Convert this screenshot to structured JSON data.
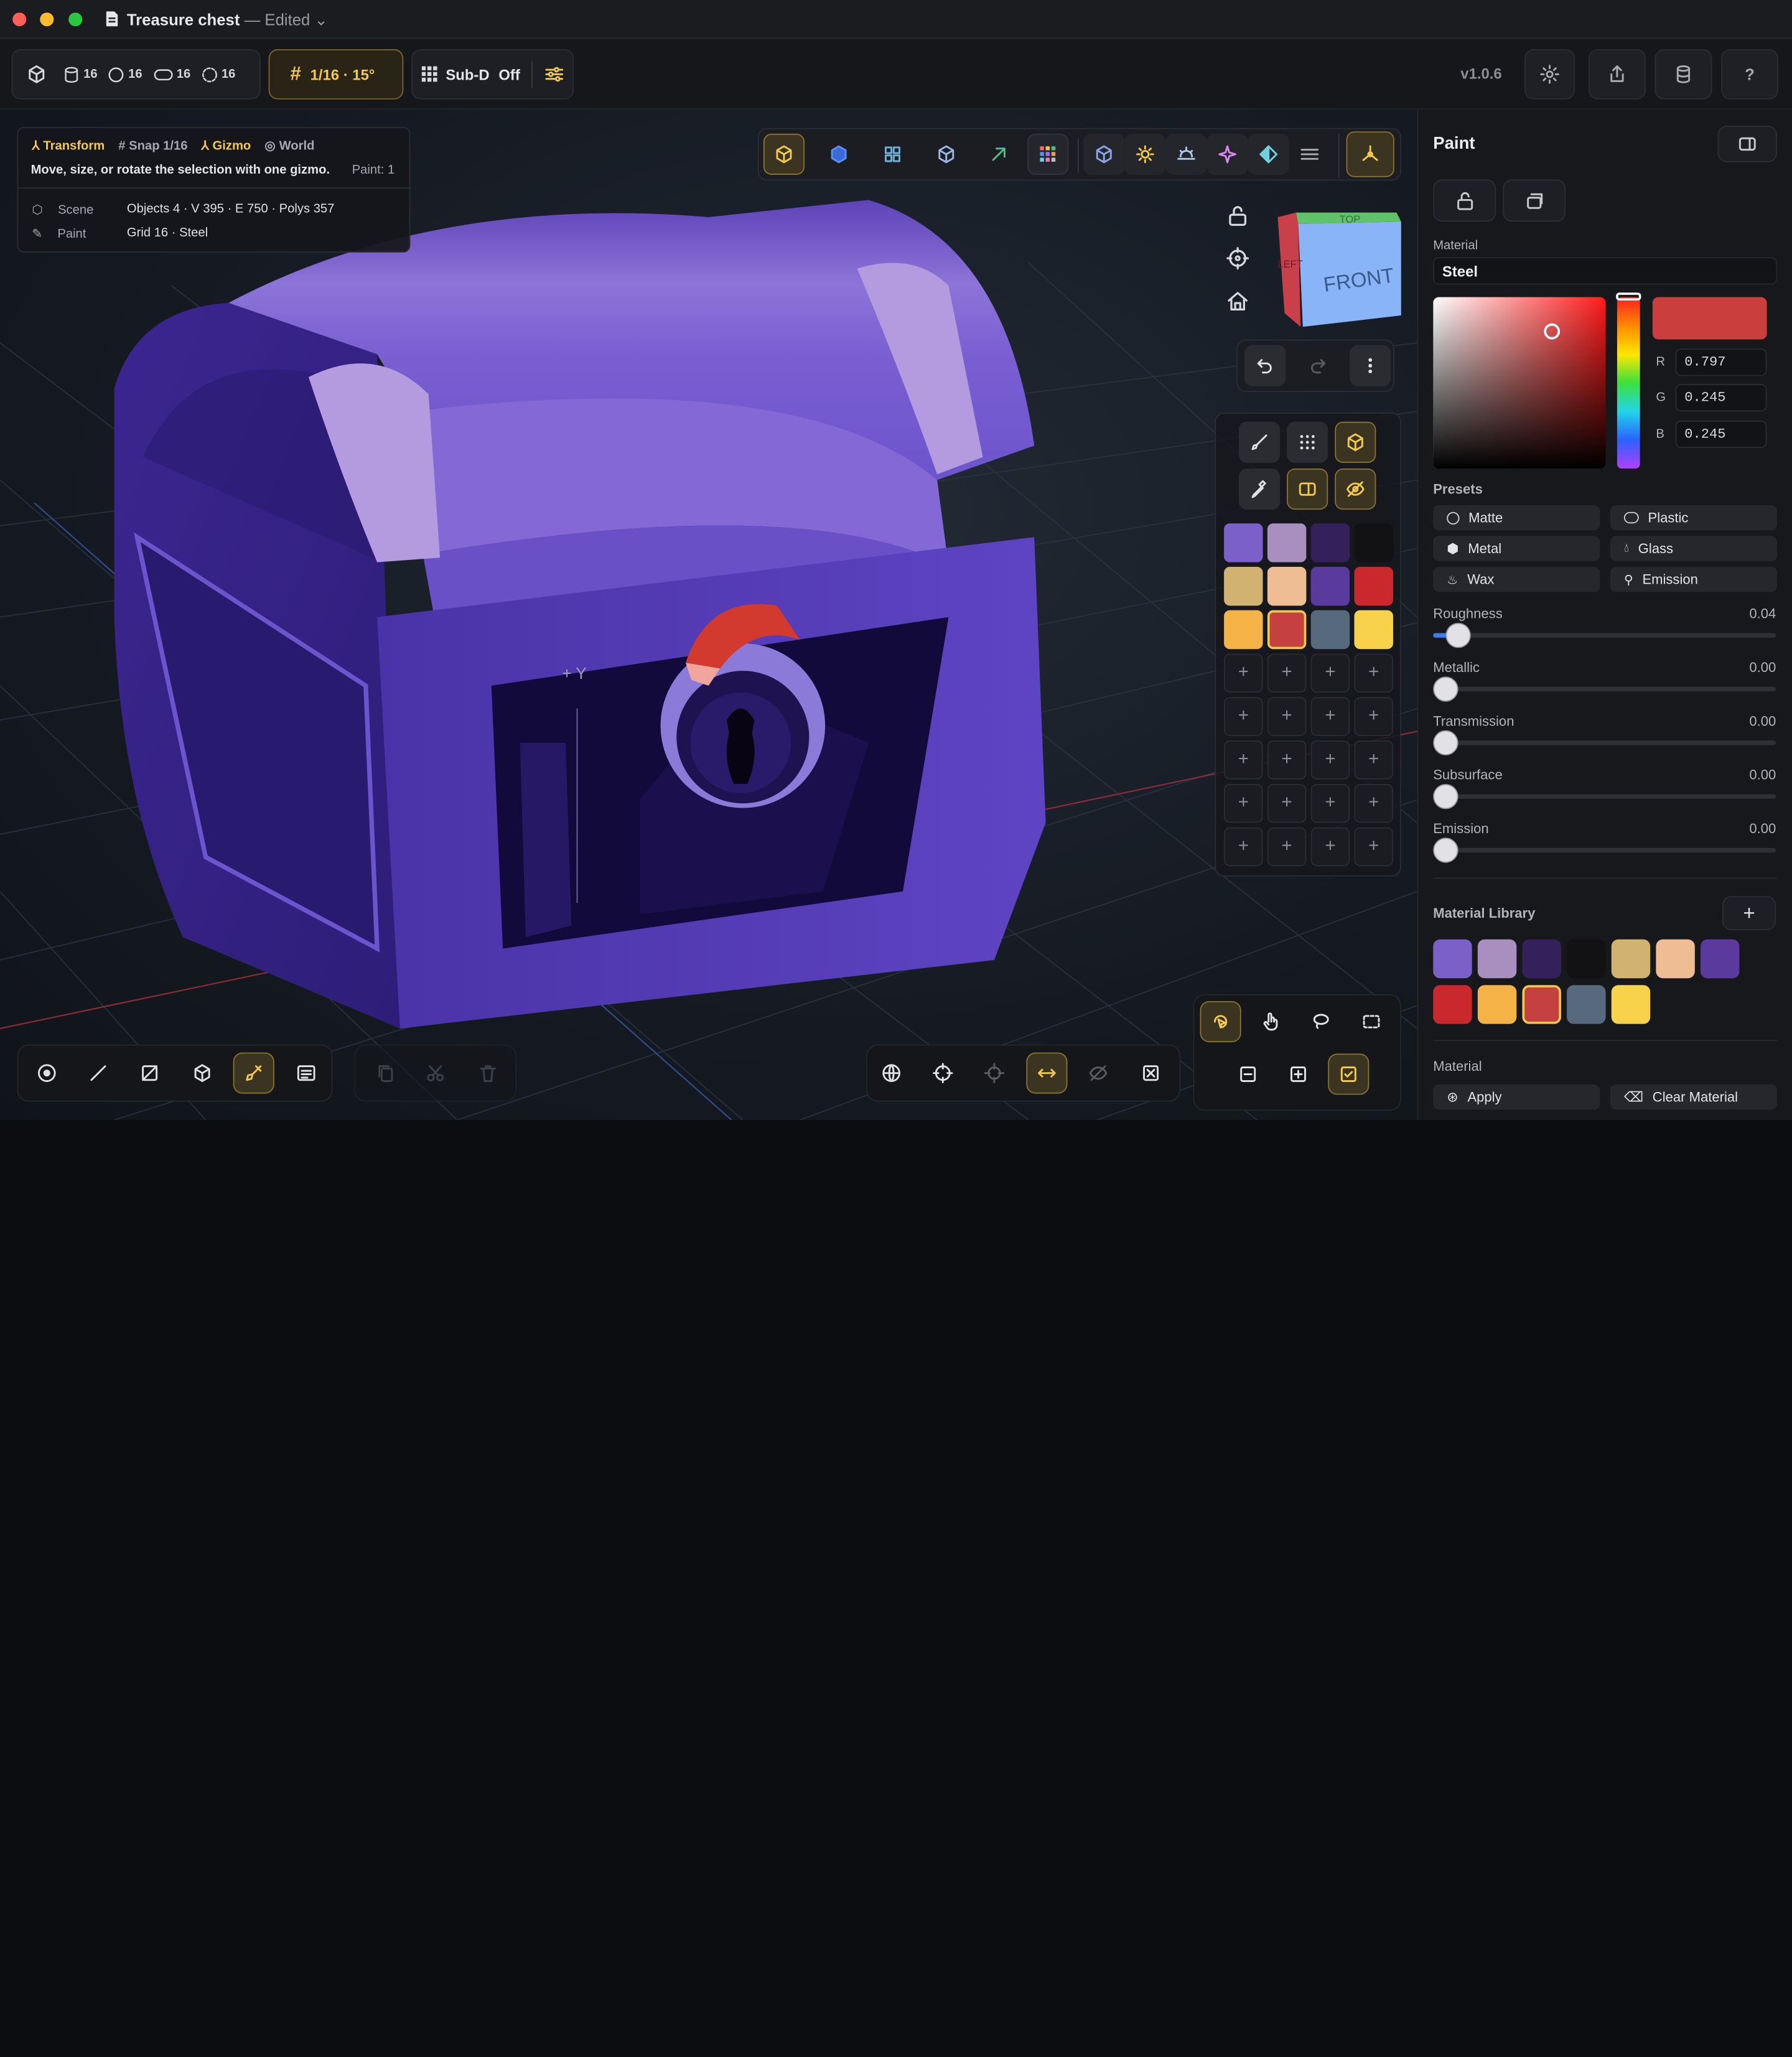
{
  "window": {
    "title": "Treasure chest",
    "separator": "—",
    "status": "Edited"
  },
  "toolbar": {
    "counts": [
      "16",
      "16",
      "16",
      "16"
    ],
    "snap": "1/16 · 15°",
    "subd_label": "Sub-D",
    "subd_state": "Off",
    "version": "v1.0.6"
  },
  "hud": {
    "mode": "Transform",
    "snap": "Snap 1/16",
    "gizmo": "Gizmo",
    "space": "World",
    "hint": "Move, size, or rotate the selection with one gizmo.",
    "paint_count": "Paint: 1",
    "scene_label": "Scene",
    "scene_value": "Objects 4 · V 395 · E 750 · Polys 357",
    "paint_label": "Paint",
    "paint_value": "Grid 16 · Steel"
  },
  "viewcube": {
    "top": "TOP",
    "front": "FRONT",
    "left": "LEFT"
  },
  "swatches": [
    "#7a60c8",
    "#a88fbf",
    "#34205a",
    "#121114",
    "#d1b271",
    "#efbd93",
    "#5a3a9c",
    "#c9292c",
    "#f5b347",
    "#c4413f",
    "#56697d",
    "#f8d24a"
  ],
  "panel": {
    "title": "Paint",
    "material_label": "Material",
    "material_name": "Steel",
    "color_hex": "#cb3e3e",
    "r_label": "R",
    "r": "0.797",
    "g_label": "G",
    "g": "0.245",
    "b_label": "B",
    "b": "0.245",
    "presets_label": "Presets",
    "presets": [
      "Matte",
      "Plastic",
      "Metal",
      "Glass",
      "Wax",
      "Emission"
    ],
    "sliders": [
      {
        "label": "Roughness",
        "value": "0.04",
        "fraction": 0.04
      },
      {
        "label": "Metallic",
        "value": "0.00",
        "fraction": 0
      },
      {
        "label": "Transmission",
        "value": "0.00",
        "fraction": 0
      },
      {
        "label": "Subsurface",
        "value": "0.00",
        "fraction": 0
      },
      {
        "label": "Emission",
        "value": "0.00",
        "fraction": 0
      }
    ],
    "library_label": "Material Library",
    "library_add": "+",
    "library": [
      "#7a60c8",
      "#a88fbf",
      "#34205a",
      "#121114",
      "#d1b271",
      "#efbd93",
      "#5a3a9c",
      "#c9292c",
      "#f5b347",
      "#c4413f",
      "#56697d",
      "#f8d24a"
    ],
    "bottom_label": "Material",
    "apply": "Apply",
    "clear": "Clear Material"
  },
  "colors": {
    "accent": "#f2c94c",
    "panel_bg": "#17181c",
    "chest": "#6a4fd0"
  }
}
